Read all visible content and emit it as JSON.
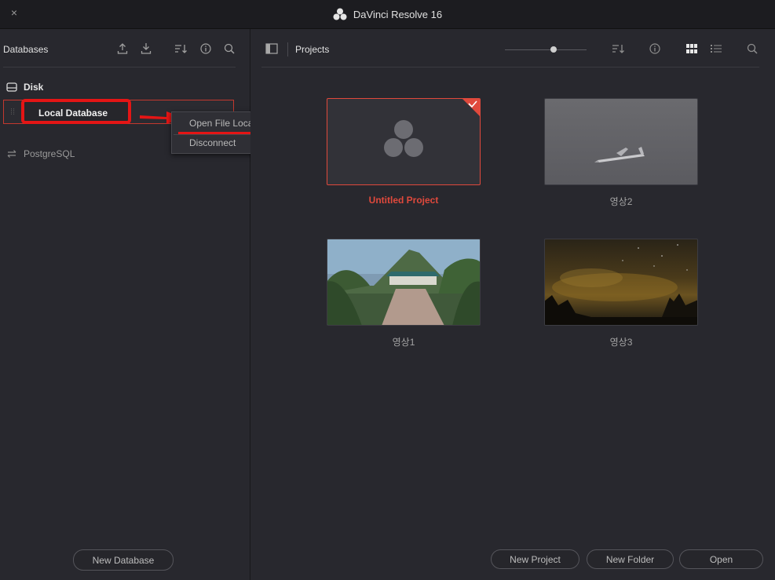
{
  "window": {
    "title": "DaVinci Resolve 16",
    "close_glyph": "×"
  },
  "databases_panel": {
    "title": "Databases",
    "groups": [
      {
        "label": "Disk",
        "icon": "disk-icon"
      },
      {
        "label": "PostgreSQL",
        "icon": "swap-arrows-icon"
      }
    ],
    "selected_database": "Local Database",
    "new_database_button": "New Database"
  },
  "context_menu": {
    "items": [
      "Open File Location",
      "Disconnect"
    ]
  },
  "projects_panel": {
    "title": "Projects",
    "slider_level": 0.6,
    "projects": [
      {
        "name": "Untitled Project",
        "selected": true
      },
      {
        "name": "영상2"
      },
      {
        "name": "영상1"
      },
      {
        "name": "영상3"
      }
    ],
    "buttons": {
      "new_project": "New Project",
      "new_folder": "New Folder",
      "open": "Open"
    }
  },
  "colors": {
    "accent_red": "#e0493c",
    "highlight_red": "#e41515",
    "background": "#28282e"
  }
}
